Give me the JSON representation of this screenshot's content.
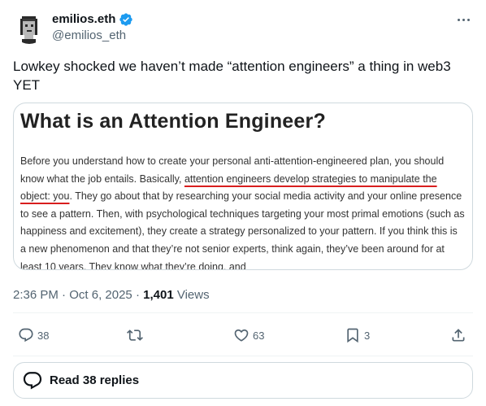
{
  "author": {
    "display_name": "emilios.eth",
    "handle": "@emilios_eth",
    "verified": true,
    "avatar_icon": "pixel-punk-avatar"
  },
  "tweet": {
    "text": "Lowkey shocked we haven’t made “attention engineers” a thing in web3 YET"
  },
  "media": {
    "title": "What is an Attention Engineer?",
    "body_before": "Before you understand how to create your personal anti-attention-engineered plan, you should know what the job entails. Basically, ",
    "body_highlight": "attention engineers develop strategies to manipulate the object: you",
    "body_after": ". They go about that by researching your social media activity and your online presence to see a pattern. Then, with psychological techniques targeting your most primal emotions (such as happiness and excitement), they create a strategy personalized to your pattern. If you think this is a new phenomenon and that they’re not senior experts, think again, they’ve been around for at least 10 years. They know what they’re doing, and",
    "highlight_color": "#d81e1e"
  },
  "meta": {
    "time": "2:36 PM",
    "separator1": " · ",
    "date": "Oct 6, 2025",
    "separator2": " · ",
    "views_count": "1,401",
    "views_label": " Views"
  },
  "actions": {
    "replies": "38",
    "retweets": "",
    "likes": "63",
    "bookmarks": "3"
  },
  "read_replies": {
    "label": "Read 38 replies"
  },
  "colors": {
    "verified": "#1d9bf0",
    "secondary_text": "#536471",
    "border": "#cfd9de"
  }
}
